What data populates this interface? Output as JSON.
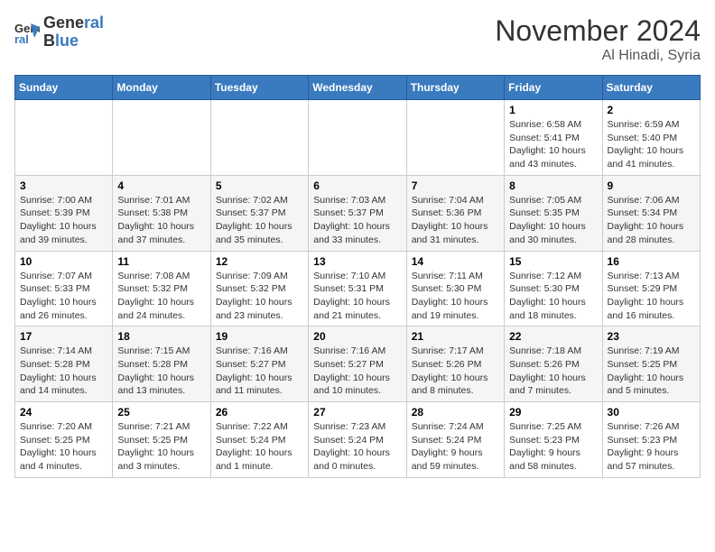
{
  "header": {
    "logo_line1": "General",
    "logo_line2": "Blue",
    "month": "November 2024",
    "location": "Al Hinadi, Syria"
  },
  "weekdays": [
    "Sunday",
    "Monday",
    "Tuesday",
    "Wednesday",
    "Thursday",
    "Friday",
    "Saturday"
  ],
  "weeks": [
    [
      {
        "day": "",
        "info": ""
      },
      {
        "day": "",
        "info": ""
      },
      {
        "day": "",
        "info": ""
      },
      {
        "day": "",
        "info": ""
      },
      {
        "day": "",
        "info": ""
      },
      {
        "day": "1",
        "info": "Sunrise: 6:58 AM\nSunset: 5:41 PM\nDaylight: 10 hours\nand 43 minutes."
      },
      {
        "day": "2",
        "info": "Sunrise: 6:59 AM\nSunset: 5:40 PM\nDaylight: 10 hours\nand 41 minutes."
      }
    ],
    [
      {
        "day": "3",
        "info": "Sunrise: 7:00 AM\nSunset: 5:39 PM\nDaylight: 10 hours\nand 39 minutes."
      },
      {
        "day": "4",
        "info": "Sunrise: 7:01 AM\nSunset: 5:38 PM\nDaylight: 10 hours\nand 37 minutes."
      },
      {
        "day": "5",
        "info": "Sunrise: 7:02 AM\nSunset: 5:37 PM\nDaylight: 10 hours\nand 35 minutes."
      },
      {
        "day": "6",
        "info": "Sunrise: 7:03 AM\nSunset: 5:37 PM\nDaylight: 10 hours\nand 33 minutes."
      },
      {
        "day": "7",
        "info": "Sunrise: 7:04 AM\nSunset: 5:36 PM\nDaylight: 10 hours\nand 31 minutes."
      },
      {
        "day": "8",
        "info": "Sunrise: 7:05 AM\nSunset: 5:35 PM\nDaylight: 10 hours\nand 30 minutes."
      },
      {
        "day": "9",
        "info": "Sunrise: 7:06 AM\nSunset: 5:34 PM\nDaylight: 10 hours\nand 28 minutes."
      }
    ],
    [
      {
        "day": "10",
        "info": "Sunrise: 7:07 AM\nSunset: 5:33 PM\nDaylight: 10 hours\nand 26 minutes."
      },
      {
        "day": "11",
        "info": "Sunrise: 7:08 AM\nSunset: 5:32 PM\nDaylight: 10 hours\nand 24 minutes."
      },
      {
        "day": "12",
        "info": "Sunrise: 7:09 AM\nSunset: 5:32 PM\nDaylight: 10 hours\nand 23 minutes."
      },
      {
        "day": "13",
        "info": "Sunrise: 7:10 AM\nSunset: 5:31 PM\nDaylight: 10 hours\nand 21 minutes."
      },
      {
        "day": "14",
        "info": "Sunrise: 7:11 AM\nSunset: 5:30 PM\nDaylight: 10 hours\nand 19 minutes."
      },
      {
        "day": "15",
        "info": "Sunrise: 7:12 AM\nSunset: 5:30 PM\nDaylight: 10 hours\nand 18 minutes."
      },
      {
        "day": "16",
        "info": "Sunrise: 7:13 AM\nSunset: 5:29 PM\nDaylight: 10 hours\nand 16 minutes."
      }
    ],
    [
      {
        "day": "17",
        "info": "Sunrise: 7:14 AM\nSunset: 5:28 PM\nDaylight: 10 hours\nand 14 minutes."
      },
      {
        "day": "18",
        "info": "Sunrise: 7:15 AM\nSunset: 5:28 PM\nDaylight: 10 hours\nand 13 minutes."
      },
      {
        "day": "19",
        "info": "Sunrise: 7:16 AM\nSunset: 5:27 PM\nDaylight: 10 hours\nand 11 minutes."
      },
      {
        "day": "20",
        "info": "Sunrise: 7:16 AM\nSunset: 5:27 PM\nDaylight: 10 hours\nand 10 minutes."
      },
      {
        "day": "21",
        "info": "Sunrise: 7:17 AM\nSunset: 5:26 PM\nDaylight: 10 hours\nand 8 minutes."
      },
      {
        "day": "22",
        "info": "Sunrise: 7:18 AM\nSunset: 5:26 PM\nDaylight: 10 hours\nand 7 minutes."
      },
      {
        "day": "23",
        "info": "Sunrise: 7:19 AM\nSunset: 5:25 PM\nDaylight: 10 hours\nand 5 minutes."
      }
    ],
    [
      {
        "day": "24",
        "info": "Sunrise: 7:20 AM\nSunset: 5:25 PM\nDaylight: 10 hours\nand 4 minutes."
      },
      {
        "day": "25",
        "info": "Sunrise: 7:21 AM\nSunset: 5:25 PM\nDaylight: 10 hours\nand 3 minutes."
      },
      {
        "day": "26",
        "info": "Sunrise: 7:22 AM\nSunset: 5:24 PM\nDaylight: 10 hours\nand 1 minute."
      },
      {
        "day": "27",
        "info": "Sunrise: 7:23 AM\nSunset: 5:24 PM\nDaylight: 10 hours\nand 0 minutes."
      },
      {
        "day": "28",
        "info": "Sunrise: 7:24 AM\nSunset: 5:24 PM\nDaylight: 9 hours\nand 59 minutes."
      },
      {
        "day": "29",
        "info": "Sunrise: 7:25 AM\nSunset: 5:23 PM\nDaylight: 9 hours\nand 58 minutes."
      },
      {
        "day": "30",
        "info": "Sunrise: 7:26 AM\nSunset: 5:23 PM\nDaylight: 9 hours\nand 57 minutes."
      }
    ]
  ]
}
